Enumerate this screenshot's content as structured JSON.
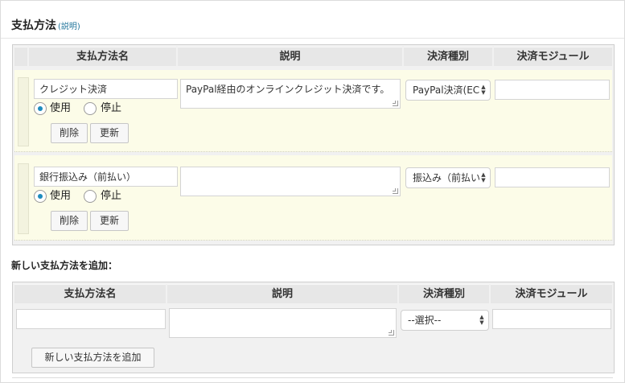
{
  "section": {
    "title": "支払方法",
    "title_note": "(説明)"
  },
  "columns": [
    "支払方法名",
    "説明",
    "決済種別",
    "決済モジュール"
  ],
  "methods": [
    {
      "name": "クレジット決済",
      "description": "PayPal経由のオンラインクレジット決済です。",
      "type": "PayPal決済(EC",
      "module": "",
      "status_use": "使用",
      "status_stop": "停止",
      "selected_status": "使用",
      "delete_label": "削除",
      "update_label": "更新"
    },
    {
      "name": "銀行振込み（前払い）",
      "description": "",
      "type": "振込み（前払い",
      "module": "",
      "status_use": "使用",
      "status_stop": "停止",
      "selected_status": "使用",
      "delete_label": "削除",
      "update_label": "更新"
    }
  ],
  "add_section": {
    "title": "新しい支払方法を追加：",
    "columns": [
      "支払方法名",
      "説明",
      "決済種別",
      "決済モジュール"
    ],
    "name_value": "",
    "description_value": "",
    "type_selected": "--選択--",
    "module_value": "",
    "add_button": "新しい支払方法を追加"
  },
  "colors": {
    "accent": "#1e8cbe",
    "row_band": "#fcfce8",
    "header": "#e7e7e7"
  }
}
